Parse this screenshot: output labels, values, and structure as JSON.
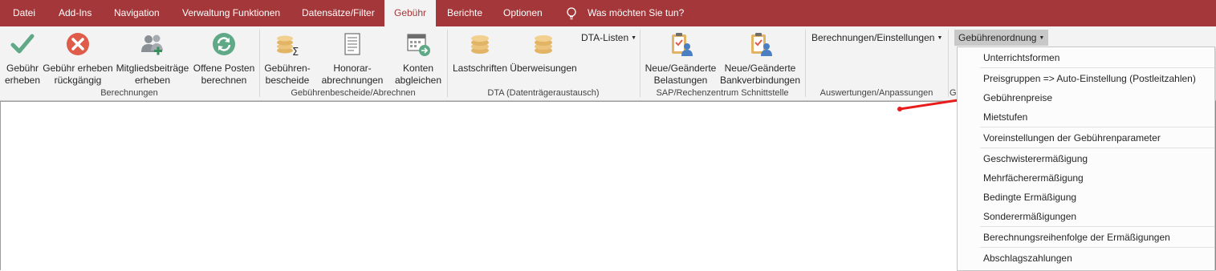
{
  "tabs": [
    "Datei",
    "Add-Ins",
    "Navigation",
    "Verwaltung Funktionen",
    "Datensätze/Filter",
    "Gebühr",
    "Berichte",
    "Optionen"
  ],
  "tell_me": "Was möchten Sie tun?",
  "ribbon": {
    "buttons": [
      {
        "line1": "Gebühr",
        "line2": "erheben",
        "icon": "check-icon"
      },
      {
        "line1": "Gebühr erheben",
        "line2": "rückgängig",
        "icon": "cancel-circle-icon"
      },
      {
        "line1": "Mitgliedsbeiträge",
        "line2": "erheben",
        "icon": "members-icon"
      },
      {
        "line1": "Offene Posten",
        "line2": "berechnen",
        "icon": "refresh-icon"
      },
      {
        "line1": "Gebühren-",
        "line2": "bescheide",
        "icon": "coins-sum-icon"
      },
      {
        "line1": "Honorar-",
        "line2": "abrechnungen",
        "icon": "document-icon"
      },
      {
        "line1": "Konten",
        "line2": "abgleichen",
        "icon": "calendar-sync-icon"
      },
      {
        "line1": "Lastschriften",
        "line2": "",
        "icon": "coins-icon"
      },
      {
        "line1": "Überweisungen",
        "line2": "",
        "icon": "coins-icon"
      },
      {
        "line1": "Neue/Geänderte",
        "line2": "Belastungen",
        "icon": "clipboard-user-icon"
      },
      {
        "line1": "Neue/Geänderte",
        "line2": "Bankverbindungen",
        "icon": "clipboard-user-icon"
      }
    ],
    "groups": [
      "Berechnungen",
      "Gebührenbescheide/Abrechnen",
      "DTA (Datenträgeraustausch)",
      "SAP/Rechenzentrum Schnittstelle",
      "Auswertungen/Anpassungen",
      "G"
    ],
    "dta_listen": "DTA-Listen",
    "berechnungen_einstellungen": "Berechnungen/Einstellungen",
    "gebuehrenordnung": "Gebührenordnung"
  },
  "menu": {
    "items": [
      "Unterrichtsformen",
      "Preisgruppen => Auto-Einstellung (Postleitzahlen)",
      "Gebührenpreise",
      "Mietstufen",
      "Voreinstellungen der Gebührenparameter",
      "Geschwisterermäßigung",
      "Mehrfächerermäßigung",
      "Bedingte Ermäßigung",
      "Sonderermäßigungen",
      "Berechnungsreihenfolge der Ermäßigungen",
      "Abschlagszahlungen"
    ]
  },
  "colors": {
    "accent": "#a4373a",
    "ribbon_bg": "#f3f3f3",
    "annotation_arrow": "#e81c1c"
  }
}
